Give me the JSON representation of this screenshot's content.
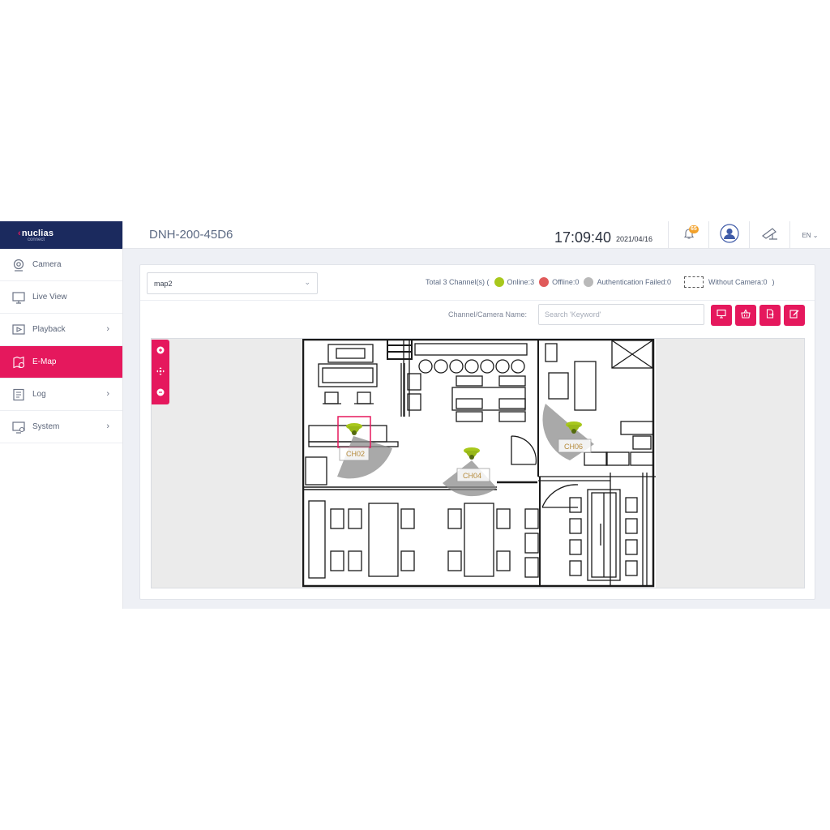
{
  "brand": {
    "name": "nuclias",
    "sub": "connect"
  },
  "sidebar": {
    "items": [
      {
        "label": "Camera",
        "icon": "camera-icon"
      },
      {
        "label": "Live View",
        "icon": "monitor-icon"
      },
      {
        "label": "Playback",
        "icon": "play-icon",
        "arrow": "›"
      },
      {
        "label": "E-Map",
        "icon": "map-icon",
        "active": true
      },
      {
        "label": "Log",
        "icon": "log-icon",
        "arrow": "›"
      },
      {
        "label": "System",
        "icon": "system-icon",
        "arrow": "›"
      }
    ]
  },
  "header": {
    "device": "DNH-200-45D6",
    "time": "17:09:40",
    "date": "2021/04/16",
    "notifications": "65",
    "language": "EN ⌄"
  },
  "toolbar": {
    "map_value": "map2",
    "legend_prefix": "Total 3 Channel(s)  (",
    "online": "Online:3",
    "offline": "Offline:0",
    "auth_failed": "Authentication Failed:0",
    "without_camera": "Without Camera:0",
    "legend_suffix": ")",
    "search_label": "Channel/Camera Name:",
    "search_placeholder": "Search 'Keyword'",
    "actions": [
      "monitor-icon",
      "basket-icon",
      "export-icon",
      "edit-icon"
    ]
  },
  "colors": {
    "accent": "#e5185d",
    "online": "#a8c81c",
    "offline": "#e05a5a",
    "auth_failed": "#b9b9b9",
    "brand_bg": "#1b2a5e"
  },
  "map": {
    "zoom_controls": [
      "zoom-in-icon",
      "pan-icon",
      "zoom-out-icon"
    ],
    "cameras": [
      {
        "label": "CH02"
      },
      {
        "label": "CH04"
      },
      {
        "label": "CH06"
      }
    ]
  }
}
